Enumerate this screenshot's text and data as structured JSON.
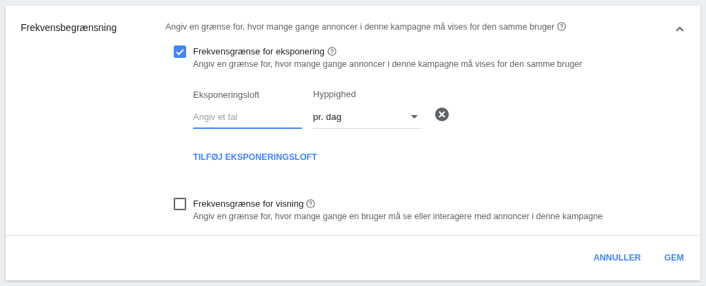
{
  "section": {
    "title": "Frekvensbegrænsning",
    "description": "Angiv en grænse for, hvor mange gange annoncer i denne kampagne må vises for den samme bruger",
    "expanded": true
  },
  "options": [
    {
      "label": "Frekvensgrænse for eksponering",
      "description": "Angiv en grænse for, hvor mange gange annoncer i denne kampagne må vises for den samme bruger",
      "checked": true,
      "caps": [
        {
          "label": "Eksponeringsloft",
          "placeholder": "Angiv et tal",
          "frequency_label": "Hyppighed",
          "frequency": "pr. dag"
        }
      ],
      "add_link": "TILFØJ EKSPONERINGSLOFT"
    },
    {
      "label": "Frekvensgrænse for visning",
      "description": "Angiv en grænse for, hvor mange gange en bruger må se eller interagere med annoncer i denne kampagne",
      "checked": false
    }
  ],
  "buttons": [
    "ANNULLER",
    "GEM"
  ]
}
